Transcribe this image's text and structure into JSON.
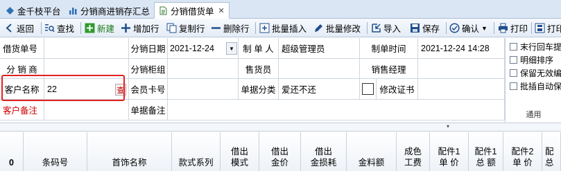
{
  "tabs": [
    {
      "label": "金千枝平台",
      "icon": "diamond-icon"
    },
    {
      "label": "分销商进销存汇总",
      "icon": "bar-chart-icon"
    },
    {
      "label": "分销借货单",
      "icon": "document-icon",
      "active": true
    }
  ],
  "toolbar": {
    "back": "返回",
    "find": "查找",
    "new": "新建",
    "add_row": "增加行",
    "copy_row": "复制行",
    "delete_row": "删除行",
    "batch_insert": "批量插入",
    "batch_edit": "批量修改",
    "import": "导入",
    "save": "保存",
    "confirm": "确认",
    "print": "打印",
    "print2": "打印"
  },
  "form": {
    "borrow_no_label": "借货单号",
    "dist_date_label": "分销日期",
    "dist_date_value": "2021-12-24",
    "creator_label": "制 单 人",
    "creator_value": "超级管理员",
    "create_time_label": "制单时间",
    "create_time_value": "2021-12-24 14:28",
    "distributor_label": "分 销 商",
    "counter_group_label": "分销柜组",
    "seller_label": "售货员",
    "sales_manager_label": "销售经理",
    "customer_name_label": "客户名称",
    "customer_name_value": "22",
    "lookup_label": "查",
    "member_card_label": "会员卡号",
    "doc_category_label": "单据分类",
    "doc_category_value": "爱还不还",
    "modify_cert_label": "修改证书",
    "customer_remark_label": "客户备注",
    "doc_remark_label": "单据备注"
  },
  "options": {
    "items": [
      "末行回车提",
      "明细排序",
      "保留无效编",
      "批插自动保"
    ],
    "footer": "通用"
  },
  "table_header": {
    "row_count": "0",
    "columns": [
      [
        "条码号"
      ],
      [
        "首饰名称"
      ],
      [
        "款式系列"
      ],
      [
        "借出",
        "模式"
      ],
      [
        "借出",
        "金价"
      ],
      [
        "借出",
        "金损耗"
      ],
      [
        "金料额"
      ],
      [
        "成色",
        "工费"
      ],
      [
        "配件1",
        "单 价"
      ],
      [
        "配件1",
        "总 额"
      ],
      [
        "配件2",
        "单 价"
      ],
      [
        "配",
        "总"
      ]
    ]
  },
  "colors": {
    "accent_red": "#e02020",
    "tab_bar": "#dbe6f4"
  }
}
